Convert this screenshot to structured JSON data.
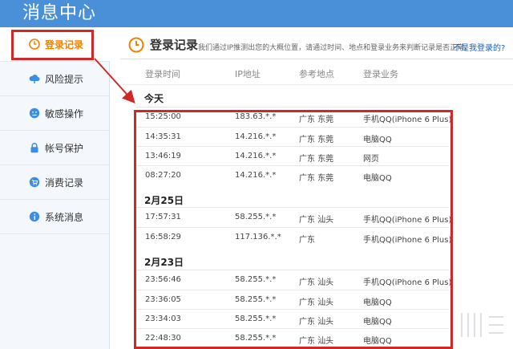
{
  "app": {
    "title": "消息中心"
  },
  "sidebar": {
    "items": [
      {
        "label": "登录记录",
        "icon": "clock-icon"
      },
      {
        "label": "风险提示",
        "icon": "cloud-icon"
      },
      {
        "label": "敏感操作",
        "icon": "face-icon"
      },
      {
        "label": "帐号保护",
        "icon": "lock-icon"
      },
      {
        "label": "消费记录",
        "icon": "cart-icon"
      },
      {
        "label": "系统消息",
        "icon": "info-icon"
      }
    ]
  },
  "main": {
    "title": "登录记录",
    "description": "我们通过IP推测出您的大概位置，请通过时间、地点和登录业务来判断记录是否正常。",
    "help_link": "不是我登录的?",
    "columns": [
      "登录时间",
      "IP地址",
      "参考地点",
      "登录业务"
    ],
    "groups": [
      {
        "label": "今天",
        "rows": [
          {
            "time": "15:25:00",
            "ip": "183.63.*.*",
            "location": "广东 东莞",
            "service": "手机QQ(iPhone 6 Plus)"
          },
          {
            "time": "14:35:31",
            "ip": "14.216.*.*",
            "location": "广东 东莞",
            "service": "电脑QQ"
          },
          {
            "time": "13:46:19",
            "ip": "14.216.*.*",
            "location": "广东 东莞",
            "service": "网页"
          },
          {
            "time": "08:27:20",
            "ip": "14.216.*.*",
            "location": "广东 东莞",
            "service": "电脑QQ"
          }
        ]
      },
      {
        "label": "2月25日",
        "rows": [
          {
            "time": "17:57:31",
            "ip": "58.255.*.*",
            "location": "广东 汕头",
            "service": "手机QQ(iPhone 6 Plus)"
          },
          {
            "time": "16:58:29",
            "ip": "117.136.*.*",
            "location": "广东",
            "service": "手机QQ(iPhone 6 Plus)"
          }
        ]
      },
      {
        "label": "2月23日",
        "rows": [
          {
            "time": "23:56:46",
            "ip": "58.255.*.*",
            "location": "广东 汕头",
            "service": "手机QQ(iPhone 6 Plus)"
          },
          {
            "time": "23:36:05",
            "ip": "58.255.*.*",
            "location": "广东 汕头",
            "service": "电脑QQ"
          },
          {
            "time": "23:34:03",
            "ip": "58.255.*.*",
            "location": "广东 汕头",
            "service": "电脑QQ"
          },
          {
            "time": "22:48:30",
            "ip": "58.255.*.*",
            "location": "广东 汕头",
            "service": "电脑QQ"
          }
        ]
      }
    ]
  },
  "colors": {
    "header_blue": "#4a90d9",
    "active_orange": "#f08300",
    "highlight_red": "#d12727",
    "icon_blue": "#3a8ee6"
  }
}
